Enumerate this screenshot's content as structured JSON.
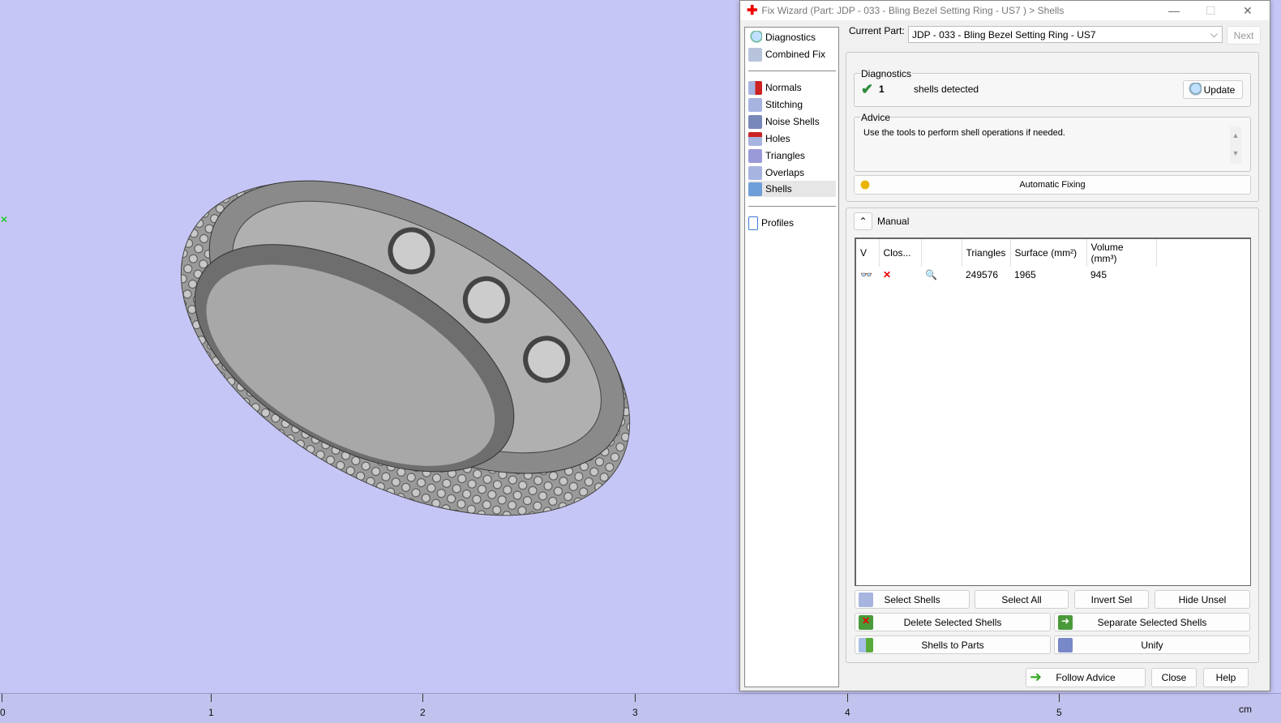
{
  "viewport": {
    "ruler_labels": [
      "0",
      "1",
      "2",
      "3",
      "4",
      "5"
    ],
    "ruler_unit": "cm"
  },
  "dialog": {
    "title": "Fix Wizard (Part: JDP - 033 - Bling Bezel Setting Ring - US7 ) > Shells",
    "nav": [
      {
        "label": "Diagnostics",
        "icon": "magnifier-icon"
      },
      {
        "label": "Combined Fix",
        "icon": "combined-fix-icon"
      },
      {
        "label": "Normals",
        "icon": "normals-cube-icon"
      },
      {
        "label": "Stitching",
        "icon": "stitching-cube-icon"
      },
      {
        "label": "Noise Shells",
        "icon": "noise-shells-icon"
      },
      {
        "label": "Holes",
        "icon": "holes-cube-icon"
      },
      {
        "label": "Triangles",
        "icon": "triangles-icon"
      },
      {
        "label": "Overlaps",
        "icon": "overlaps-icon"
      },
      {
        "label": "Shells",
        "icon": "shells-cube-icon",
        "selected": true
      },
      {
        "label": "Profiles",
        "icon": "document-icon"
      }
    ],
    "current_part_label": "Current Part:",
    "current_part_value": "JDP - 033 - Bling Bezel Setting Ring - US7",
    "next_label": "Next",
    "diagnostics": {
      "title": "Diagnostics",
      "count": "1",
      "text": "shells detected",
      "update_label": "Update"
    },
    "advice": {
      "title": "Advice",
      "text": "Use the tools to perform shell operations if needed."
    },
    "automatic_fixing_label": "Automatic Fixing",
    "manual": {
      "title": "Manual",
      "columns": [
        "V",
        "Clos...",
        "",
        "Triangles",
        "Surface (mm²)",
        "Volume (mm³)"
      ],
      "rows": [
        {
          "triangles": "249576",
          "surface": "1965",
          "volume": "945"
        }
      ]
    },
    "buttons": {
      "select_shells": "Select Shells",
      "select_all": "Select All",
      "invert_sel": "Invert Sel",
      "hide_unsel": "Hide Unsel",
      "delete_selected": "Delete Selected Shells",
      "separate_selected": "Separate Selected Shells",
      "shells_to_parts": "Shells to Parts",
      "unify": "Unify",
      "follow_advice": "Follow Advice",
      "close": "Close",
      "help": "Help"
    }
  }
}
